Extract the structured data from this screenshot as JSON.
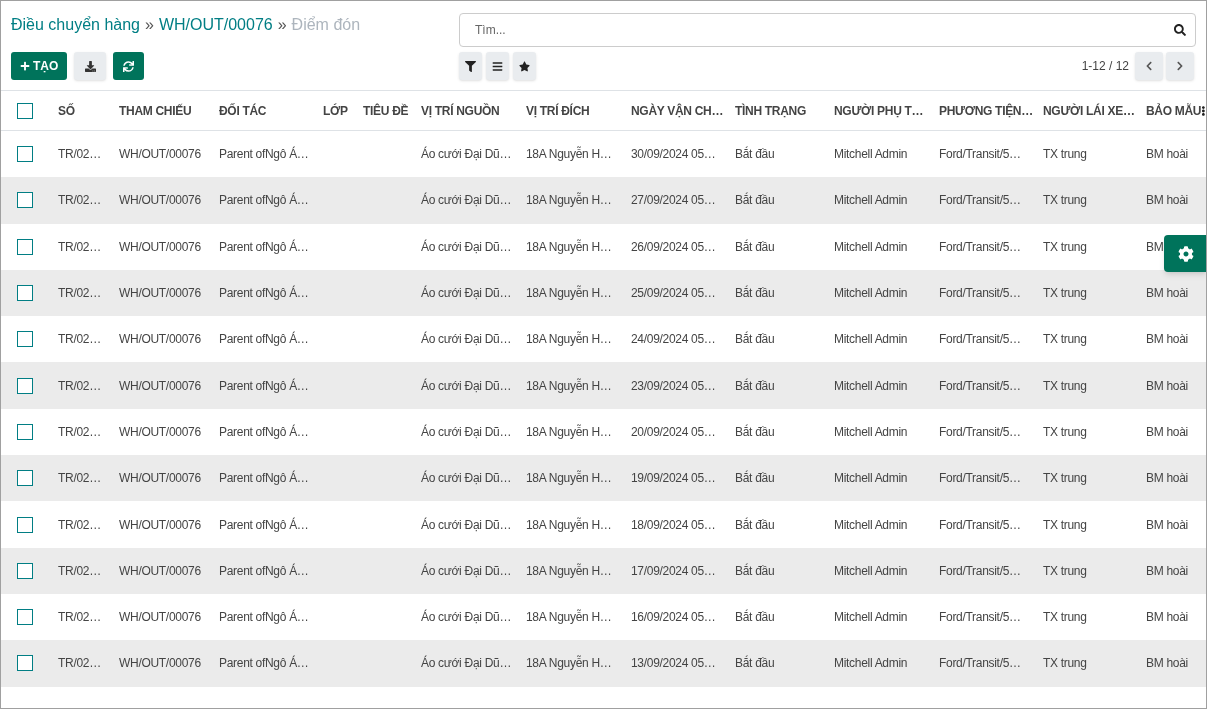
{
  "breadcrumb": [
    {
      "label": "Điều chuyển hàng",
      "current": false
    },
    {
      "label": "WH/OUT/00076",
      "current": false
    },
    {
      "label": "Điểm đón",
      "current": true
    }
  ],
  "breadcrumb_separator": "»",
  "create_button": "TẠO",
  "search": {
    "placeholder": "Tìm..."
  },
  "pager": "1-12 / 12",
  "table": {
    "select_all": false,
    "columns": [
      "SỐ",
      "THAM CHIẾU",
      "ĐỐI TÁC",
      "LỚP",
      "TIÊU ĐỀ",
      "VỊ TRÍ NGUỒN",
      "VỊ TRÍ ĐÍCH",
      "NGÀY VẬN CH…",
      "TÌNH TRẠNG",
      "NGƯỜI PHỤ T…",
      "PHƯƠNG TIỆN…",
      "NGƯỜI LÁI XE…",
      "BẢO MẪU"
    ],
    "rows": [
      {
        "selected": false,
        "cells": [
          "TR/02…",
          "WH/OUT/00076",
          "Parent ofNgô Á…",
          "",
          "",
          "Áo cưới Đại Dũ…",
          "18A Nguyễn H…",
          "30/09/2024 05…",
          "Bắt đầu",
          "Mitchell Admin",
          "Ford/Transit/5…",
          "TX trung",
          "BM hoài"
        ]
      },
      {
        "selected": false,
        "cells": [
          "TR/02…",
          "WH/OUT/00076",
          "Parent ofNgô Á…",
          "",
          "",
          "Áo cưới Đại Dũ…",
          "18A Nguyễn H…",
          "27/09/2024 05…",
          "Bắt đầu",
          "Mitchell Admin",
          "Ford/Transit/5…",
          "TX trung",
          "BM hoài"
        ]
      },
      {
        "selected": false,
        "cells": [
          "TR/02…",
          "WH/OUT/00076",
          "Parent ofNgô Á…",
          "",
          "",
          "Áo cưới Đại Dũ…",
          "18A Nguyễn H…",
          "26/09/2024 05…",
          "Bắt đầu",
          "Mitchell Admin",
          "Ford/Transit/5…",
          "TX trung",
          "BM"
        ]
      },
      {
        "selected": false,
        "cells": [
          "TR/02…",
          "WH/OUT/00076",
          "Parent ofNgô Á…",
          "",
          "",
          "Áo cưới Đại Dũ…",
          "18A Nguyễn H…",
          "25/09/2024 05…",
          "Bắt đầu",
          "Mitchell Admin",
          "Ford/Transit/5…",
          "TX trung",
          "BM hoài"
        ]
      },
      {
        "selected": false,
        "cells": [
          "TR/02…",
          "WH/OUT/00076",
          "Parent ofNgô Á…",
          "",
          "",
          "Áo cưới Đại Dũ…",
          "18A Nguyễn H…",
          "24/09/2024 05…",
          "Bắt đầu",
          "Mitchell Admin",
          "Ford/Transit/5…",
          "TX trung",
          "BM hoài"
        ]
      },
      {
        "selected": false,
        "cells": [
          "TR/02…",
          "WH/OUT/00076",
          "Parent ofNgô Á…",
          "",
          "",
          "Áo cưới Đại Dũ…",
          "18A Nguyễn H…",
          "23/09/2024 05…",
          "Bắt đầu",
          "Mitchell Admin",
          "Ford/Transit/5…",
          "TX trung",
          "BM hoài"
        ]
      },
      {
        "selected": false,
        "cells": [
          "TR/02…",
          "WH/OUT/00076",
          "Parent ofNgô Á…",
          "",
          "",
          "Áo cưới Đại Dũ…",
          "18A Nguyễn H…",
          "20/09/2024 05…",
          "Bắt đầu",
          "Mitchell Admin",
          "Ford/Transit/5…",
          "TX trung",
          "BM hoài"
        ]
      },
      {
        "selected": false,
        "cells": [
          "TR/02…",
          "WH/OUT/00076",
          "Parent ofNgô Á…",
          "",
          "",
          "Áo cưới Đại Dũ…",
          "18A Nguyễn H…",
          "19/09/2024 05…",
          "Bắt đầu",
          "Mitchell Admin",
          "Ford/Transit/5…",
          "TX trung",
          "BM hoài"
        ]
      },
      {
        "selected": false,
        "cells": [
          "TR/02…",
          "WH/OUT/00076",
          "Parent ofNgô Á…",
          "",
          "",
          "Áo cưới Đại Dũ…",
          "18A Nguyễn H…",
          "18/09/2024 05…",
          "Bắt đầu",
          "Mitchell Admin",
          "Ford/Transit/5…",
          "TX trung",
          "BM hoài"
        ]
      },
      {
        "selected": false,
        "cells": [
          "TR/02…",
          "WH/OUT/00076",
          "Parent ofNgô Á…",
          "",
          "",
          "Áo cưới Đại Dũ…",
          "18A Nguyễn H…",
          "17/09/2024 05…",
          "Bắt đầu",
          "Mitchell Admin",
          "Ford/Transit/5…",
          "TX trung",
          "BM hoài"
        ]
      },
      {
        "selected": false,
        "cells": [
          "TR/02…",
          "WH/OUT/00076",
          "Parent ofNgô Á…",
          "",
          "",
          "Áo cưới Đại Dũ…",
          "18A Nguyễn H…",
          "16/09/2024 05…",
          "Bắt đầu",
          "Mitchell Admin",
          "Ford/Transit/5…",
          "TX trung",
          "BM hoài"
        ]
      },
      {
        "selected": false,
        "cells": [
          "TR/02…",
          "WH/OUT/00076",
          "Parent ofNgô Á…",
          "",
          "",
          "Áo cưới Đại Dũ…",
          "18A Nguyễn H…",
          "13/09/2024 05…",
          "Bắt đầu",
          "Mitchell Admin",
          "Ford/Transit/5…",
          "TX trung",
          "BM hoài"
        ]
      }
    ]
  }
}
